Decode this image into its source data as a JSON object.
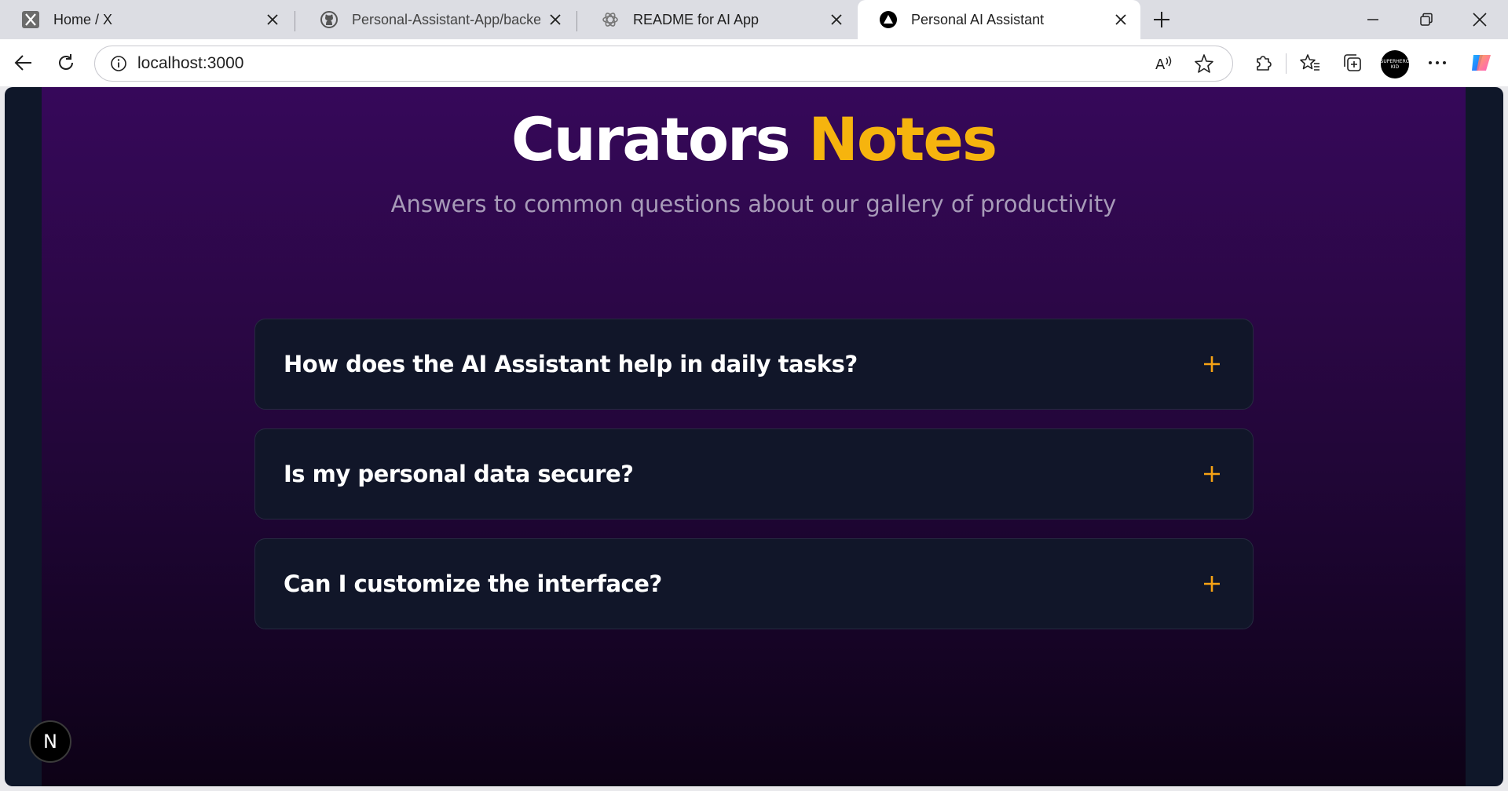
{
  "tabs": [
    {
      "title": "Home / X",
      "icon": "x-logo-icon"
    },
    {
      "title": "Personal-Assistant-App/backend/",
      "icon": "github-icon"
    },
    {
      "title": "README for AI App",
      "icon": "openai-icon"
    },
    {
      "title": "Personal AI Assistant",
      "icon": "nextjs-triangle-icon",
      "active": true
    }
  ],
  "address_bar": {
    "url": "localhost:3000"
  },
  "profile": {
    "label": "SUPERHERO KID"
  },
  "page": {
    "heading_main": "Curators",
    "heading_accent": "Notes",
    "subtitle": "Answers to common questions about our gallery of productivity",
    "faq": [
      {
        "question": "How does the AI Assistant help in daily tasks?"
      },
      {
        "question": "Is my personal data secure?"
      },
      {
        "question": "Can I customize the interface?"
      }
    ],
    "dev_badge": "N"
  },
  "colors": {
    "accent": "#f6b40e",
    "card_bg": "#111629",
    "page_bg_top": "#36085a",
    "page_bg_bottom": "#0d0216"
  }
}
